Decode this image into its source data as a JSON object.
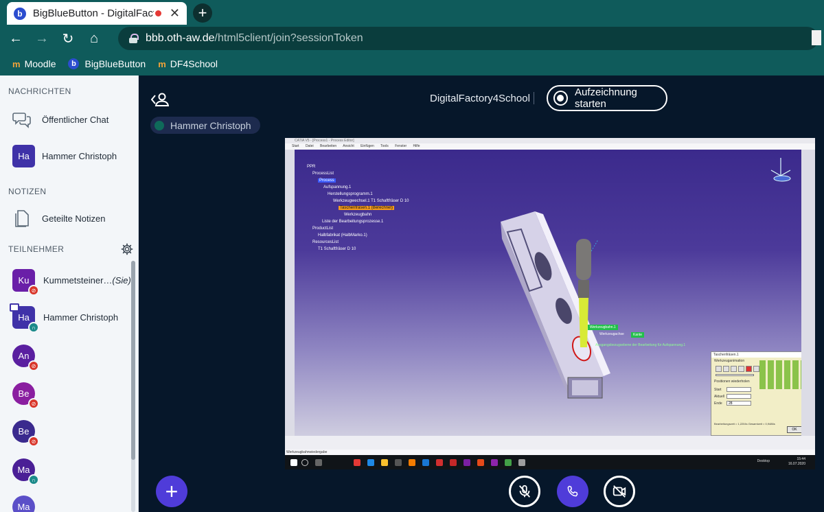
{
  "browser": {
    "tab_title": "BigBlueButton - DigitalFactor",
    "tab_favicon": "b",
    "new_tab_label": "+",
    "url_host": "bbb.oth-aw.de",
    "url_path": "/html5client/join?sessionToken",
    "bookmarks": [
      "Moodle",
      "BigBlueButton",
      "DF4School"
    ]
  },
  "sidebar": {
    "messages_header": "NACHRICHTEN",
    "public_chat": "Öffentlicher Chat",
    "private_chat": {
      "initials": "Ha",
      "name": "Hammer Christoph"
    },
    "notes_header": "NOTIZEN",
    "shared_notes": "Geteilte Notizen",
    "participants_header": "TEILNEHMER",
    "participants": [
      {
        "initials": "Ku",
        "name": "Kummetsteiner…",
        "suffix": "(Sie)",
        "color": "#6a1fa8",
        "shape": "square",
        "badge": "red"
      },
      {
        "initials": "Ha",
        "name": "Hammer Christoph",
        "color": "#3f32a8",
        "shape": "square",
        "badge": "teal",
        "presenter": true
      },
      {
        "initials": "An",
        "name": "",
        "color": "#5a1fa0",
        "shape": "round",
        "badge": "red"
      },
      {
        "initials": "Be",
        "name": "",
        "color": "#8a1ea0",
        "shape": "round",
        "badge": "red"
      },
      {
        "initials": "Be",
        "name": "",
        "color": "#3a2a8e",
        "shape": "round",
        "badge": "red"
      },
      {
        "initials": "Ma",
        "name": "",
        "color": "#4a1f96",
        "shape": "round",
        "badge": "teal"
      },
      {
        "initials": "Ma",
        "name": "",
        "color": "#5b4fc8",
        "shape": "round",
        "badge": ""
      }
    ]
  },
  "main": {
    "meeting_name": "DigitalFactory4School",
    "record_button": "Aufzeichnung starten",
    "talking_indicator": "Hammer Christoph"
  },
  "shared_screen": {
    "window_title": "CATIA V5 - [Process1 - Process Editor]",
    "menu": "Start Datei Bearbeiten Ansicht Einfügen Tools Fenster Hilfe",
    "tree": [
      "PPR",
      "ProcessList",
      "Process",
      "Aufspannung.1",
      "Herstellungsprogramm.1",
      "Werkzeugwechsel.1 T1 Schaftfräser D 10",
      "Taschenfräsen.1 (Berechnet)",
      "Werkzeugbahn",
      "Liste der Bearbeitungsprozesse.1",
      "ProductList",
      "Halbfabrikat (HalbMarko.1)",
      "ResourcesList",
      "T1 Schaftfräser D 10"
    ],
    "annotations": [
      "Werkzeugbahn.1",
      "Werkzeugachse",
      "Kante",
      "Ausgangsbezugsebene der Bearbeitung für Aufspannung.1"
    ],
    "panel": {
      "title": "Taschenfräsen.1",
      "section": "Werkzeuganimation",
      "replay_label": "Positionen wiederholen",
      "fields": [
        "Start",
        "Aktuell",
        "Ende"
      ],
      "end_value": "28",
      "footer": "Bearbeitungszeit = 1,2204s  Gesamtzeit = 0,9486s",
      "ok_label": "OK"
    },
    "status": "Werkzeugbahnwiedergabe",
    "clock": [
      "15:44",
      "16.07.2020"
    ],
    "taskbar_search": "Desktop"
  }
}
